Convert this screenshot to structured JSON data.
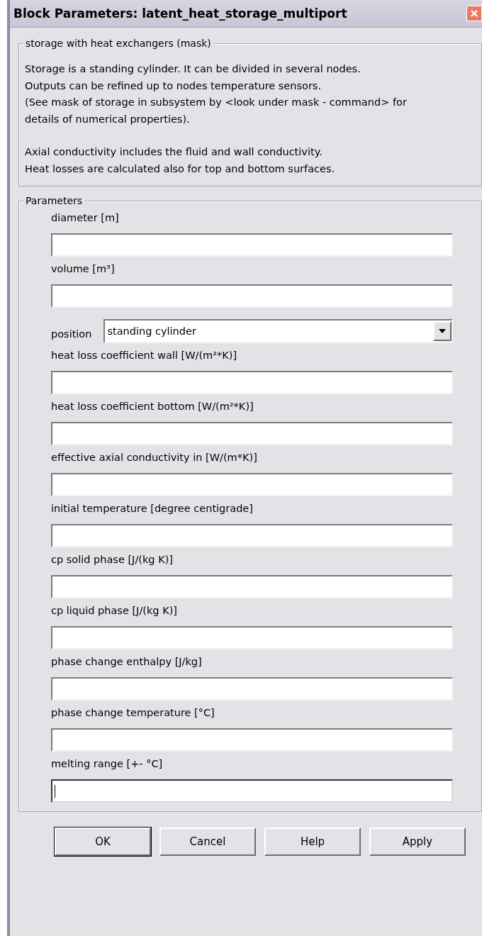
{
  "window": {
    "title": "Block Parameters: latent_heat_storage_multiport"
  },
  "mask_group": {
    "title": "storage with heat exchangers (mask)",
    "paragraphs": [
      {
        "lines": [
          "Storage is a standing cylinder. It can be divided in several nodes.",
          "Outputs can be refined up to nodes temperature sensors.",
          "(See mask of storage in subsystem by <look under mask - command> for",
          "details of numerical properties)."
        ]
      },
      {
        "lines": [
          "Axial conductivity includes the fluid and wall conductivity.",
          "Heat losses are calculated also for top and bottom surfaces."
        ]
      }
    ]
  },
  "parameters": {
    "title": "Parameters",
    "fields": [
      {
        "kind": "text",
        "label": "diameter [m]",
        "focused": false
      },
      {
        "kind": "text",
        "label": "volume [m³]",
        "focused": false
      },
      {
        "kind": "popup",
        "label": "position",
        "value": "standing cylinder"
      },
      {
        "kind": "text",
        "label": "heat loss coefficient wall [W/(m²*K)]",
        "focused": false
      },
      {
        "kind": "text",
        "label": "heat loss coefficient bottom [W/(m²*K)]",
        "focused": false
      },
      {
        "kind": "text",
        "label": "effective axial conductivity in [W/(m*K)]",
        "focused": false
      },
      {
        "kind": "text",
        "label": "initial temperature [degree centigrade]",
        "focused": false
      },
      {
        "kind": "text",
        "label": "cp solid phase [J/(kg K)]",
        "focused": false
      },
      {
        "kind": "text",
        "label": "cp liquid phase [J/(kg K)]",
        "focused": false
      },
      {
        "kind": "text",
        "label": "phase change enthalpy [J/kg]",
        "focused": false
      },
      {
        "kind": "text",
        "label": "phase change temperature [°C]",
        "focused": false
      },
      {
        "kind": "text",
        "label": "melting range [+- °C]",
        "focused": true
      }
    ]
  },
  "buttons": [
    {
      "label": "OK",
      "default": true
    },
    {
      "label": "Cancel",
      "default": false
    },
    {
      "label": "Help",
      "default": false
    },
    {
      "label": "Apply",
      "default": false
    }
  ]
}
